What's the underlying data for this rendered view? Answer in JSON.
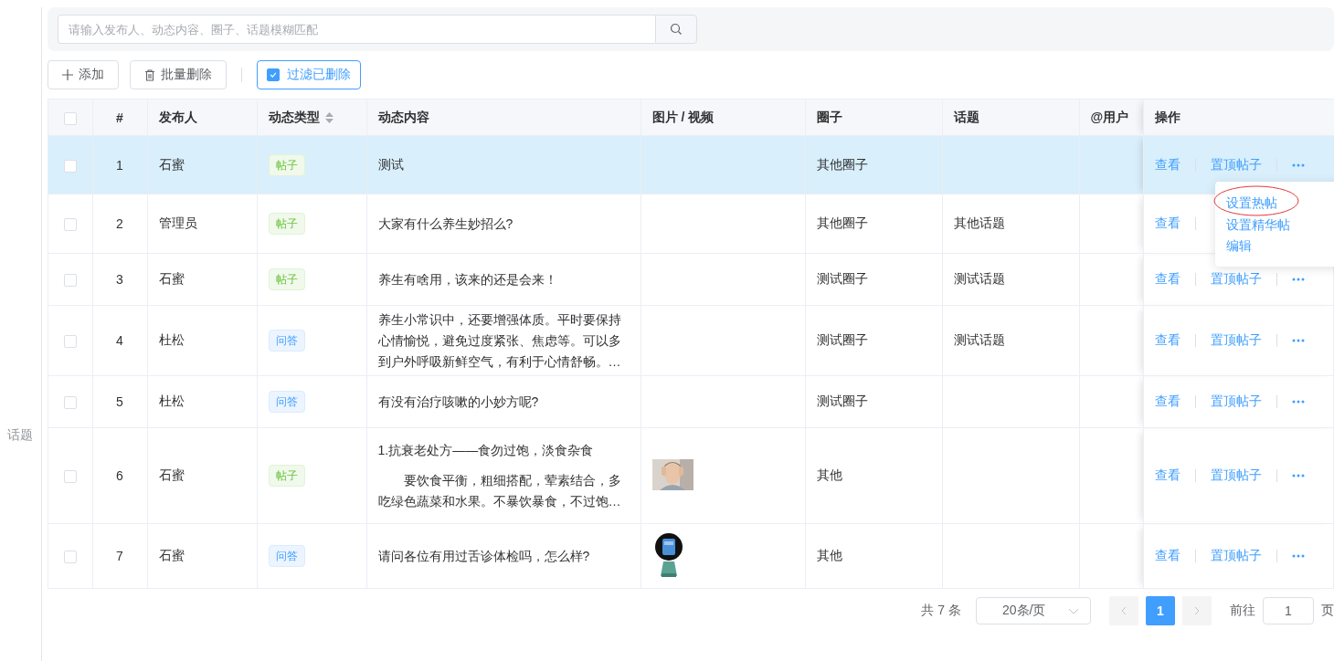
{
  "sidebar": {
    "items": [
      {
        "label": "话题"
      }
    ]
  },
  "search": {
    "placeholder": "请输入发布人、动态内容、圈子、话题模糊匹配"
  },
  "toolbar": {
    "add": "添加",
    "batch_delete": "批量删除",
    "filter": {
      "label": "过滤已删除",
      "checked": true
    }
  },
  "table": {
    "select_all": {
      "checked": false
    },
    "columns": [
      {
        "label": "#"
      },
      {
        "label": "发布人"
      },
      {
        "label": "动态类型",
        "sortable": true
      },
      {
        "label": "动态内容"
      },
      {
        "label": "图片 / 视频"
      },
      {
        "label": "圈子"
      },
      {
        "label": "话题"
      },
      {
        "label": "@用户"
      },
      {
        "label": "操作"
      }
    ],
    "rows": [
      {
        "selected": true,
        "checked": false,
        "index": "1",
        "publisher": "石蜜",
        "type": {
          "kind": "post",
          "label": "帖子"
        },
        "content": [
          "测试"
        ],
        "media": null,
        "circle": "其他圈子",
        "topic": "",
        "actions": [
          "查看",
          "置顶帖子"
        ],
        "more": true
      },
      {
        "selected": false,
        "checked": false,
        "index": "2",
        "publisher": "管理员",
        "type": {
          "kind": "post",
          "label": "帖子"
        },
        "content": [
          "大家有什么养生妙招么?"
        ],
        "media": null,
        "circle": "其他圈子",
        "topic": "其他话题",
        "actions": [
          "查看"
        ],
        "more": false
      },
      {
        "selected": false,
        "checked": false,
        "index": "3",
        "publisher": "石蜜",
        "type": {
          "kind": "post",
          "label": "帖子"
        },
        "content": [
          "养生有啥用，该来的还是会来！"
        ],
        "media": null,
        "circle": "测试圈子",
        "topic": "测试话题",
        "actions": [
          "查看",
          "置顶帖子"
        ],
        "more": true
      },
      {
        "selected": false,
        "checked": false,
        "index": "4",
        "publisher": "杜松",
        "type": {
          "kind": "qa",
          "label": "问答"
        },
        "content": [
          "养生小常识中，还要增强体质。平时要保持心情愉悦，避免过度紧张、焦虑等。可以多到户外呼吸新鲜空气，有利于心情舒畅。…"
        ],
        "media": null,
        "circle": "测试圈子",
        "topic": "测试话题",
        "actions": [
          "查看",
          "置顶帖子"
        ],
        "more": true
      },
      {
        "selected": false,
        "checked": false,
        "index": "5",
        "publisher": "杜松",
        "type": {
          "kind": "qa",
          "label": "问答"
        },
        "content": [
          "有没有治疗咳嗽的小妙方呢?"
        ],
        "media": null,
        "circle": "测试圈子",
        "topic": "",
        "actions": [
          "查看",
          "置顶帖子"
        ],
        "more": true
      },
      {
        "selected": false,
        "checked": false,
        "index": "6",
        "publisher": "石蜜",
        "type": {
          "kind": "post",
          "label": "帖子"
        },
        "content": [
          "1.抗衰老处方——食勿过饱，淡食杂食",
          "　　要饮食平衡，粗细搭配，荤素结合，多吃绿色蔬菜和水果。不暴饮暴食，不过饱…"
        ],
        "media": {
          "kind": "picture"
        },
        "circle": "其他",
        "topic": "",
        "actions": [
          "查看",
          "置顶帖子"
        ],
        "more": true
      },
      {
        "selected": false,
        "checked": false,
        "index": "7",
        "publisher": "石蜜",
        "type": {
          "kind": "qa",
          "label": "问答"
        },
        "content": [
          "请问各位有用过舌诊体检吗，怎么样?"
        ],
        "media": {
          "kind": "picture"
        },
        "circle": "其他",
        "topic": "",
        "actions": [
          "查看",
          "置顶帖子"
        ],
        "more": true
      }
    ]
  },
  "row_menu": {
    "items": [
      {
        "label": "设置热帖",
        "annotated": true
      },
      {
        "label": "设置精华帖",
        "annotated": false
      },
      {
        "label": "编辑",
        "annotated": false
      }
    ]
  },
  "pagination": {
    "total": "共 7 条",
    "page_size": "20条/页",
    "pages": [
      {
        "label": "1",
        "selected": true
      }
    ],
    "goto_label": "前往",
    "goto_value": "1",
    "page_suffix": "页"
  }
}
